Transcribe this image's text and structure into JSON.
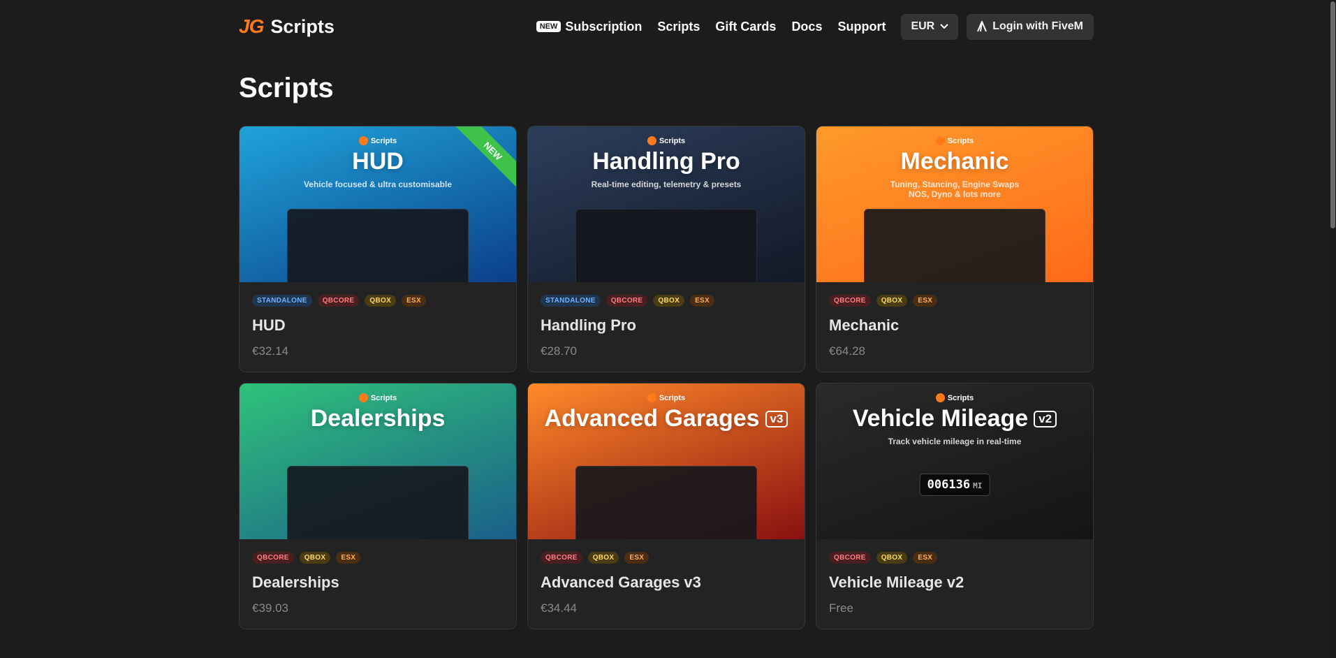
{
  "brand": {
    "mark": "JG",
    "name": "Scripts"
  },
  "nav": {
    "new_badge": "NEW",
    "items": [
      "Subscription",
      "Scripts",
      "Gift Cards",
      "Docs",
      "Support"
    ],
    "currency": "EUR",
    "login": "Login with FiveM"
  },
  "page": {
    "title": "Scripts"
  },
  "cards": [
    {
      "banner_brand": "Scripts",
      "banner_title": "HUD",
      "banner_version": "",
      "banner_subtitle": "Vehicle focused & ultra customisable",
      "ribbon": "NEW",
      "tags": [
        "STANDALONE",
        "QBCORE",
        "QBOX",
        "ESX"
      ],
      "title": "HUD",
      "price": "€32.14",
      "bg_from": "#1fa3d9",
      "bg_to": "#0b3f8a"
    },
    {
      "banner_brand": "Scripts",
      "banner_title": "Handling Pro",
      "banner_version": "",
      "banner_subtitle": "Real-time editing, telemetry & presets",
      "ribbon": "",
      "tags": [
        "STANDALONE",
        "QBCORE",
        "QBOX",
        "ESX"
      ],
      "title": "Handling Pro",
      "price": "€28.70",
      "bg_from": "#2d3e5c",
      "bg_to": "#121826"
    },
    {
      "banner_brand": "Scripts",
      "banner_title": "Mechanic",
      "banner_version": "",
      "banner_subtitle": "Tuning, Stancing, Engine Swaps\nNOS, Dyno & lots more",
      "ribbon": "",
      "tags": [
        "QBCORE",
        "QBOX",
        "ESX"
      ],
      "title": "Mechanic",
      "price": "€64.28",
      "bg_from": "#ff9a2a",
      "bg_to": "#ff6a1a"
    },
    {
      "banner_brand": "Scripts",
      "banner_title": "Dealerships",
      "banner_version": "",
      "banner_subtitle": "",
      "ribbon": "",
      "tags": [
        "QBCORE",
        "QBOX",
        "ESX"
      ],
      "title": "Dealerships",
      "price": "€39.03",
      "bg_from": "#2fc27a",
      "bg_to": "#1a5f8a"
    },
    {
      "banner_brand": "Scripts",
      "banner_title": "Advanced Garages",
      "banner_version": "v3",
      "banner_subtitle": "",
      "ribbon": "",
      "tags": [
        "QBCORE",
        "QBOX",
        "ESX"
      ],
      "title": "Advanced Garages v3",
      "price": "€34.44",
      "bg_from": "#ff8a2a",
      "bg_to": "#8a1010"
    },
    {
      "banner_brand": "Scripts",
      "banner_title": "Vehicle Mileage",
      "banner_version": "v2",
      "banner_subtitle": "Track vehicle mileage in real-time",
      "ribbon": "",
      "tags": [
        "QBCORE",
        "QBOX",
        "ESX"
      ],
      "title": "Vehicle Mileage v2",
      "price": "Free",
      "bg_from": "#2a2a2a",
      "bg_to": "#141414",
      "odometer": "006136",
      "odometer_unit": "MI"
    }
  ]
}
